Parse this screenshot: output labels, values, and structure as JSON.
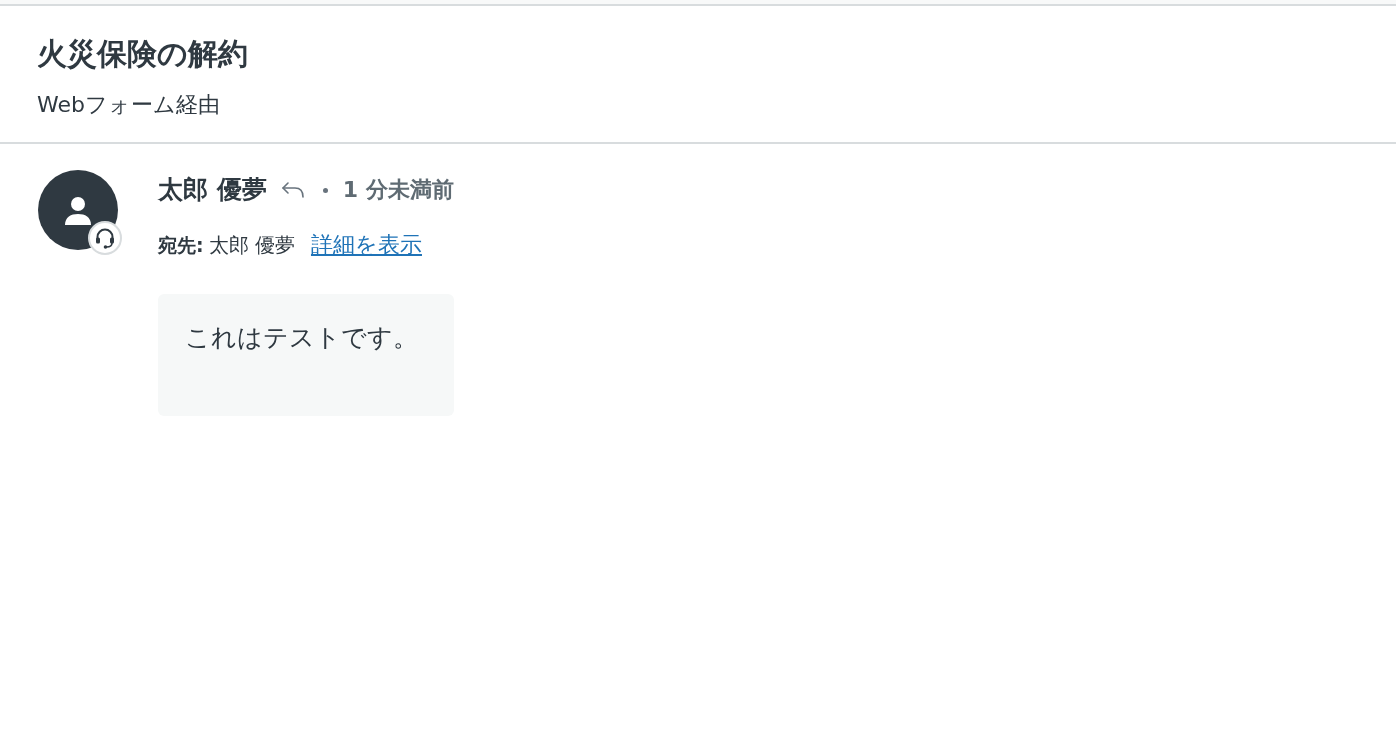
{
  "ticket": {
    "title": "火災保険の解約",
    "channel": "Webフォーム経由"
  },
  "messages": [
    {
      "author": "太郎 優夢",
      "time": "1 分未満前",
      "to_label": "宛先:",
      "to": "太郎 優夢",
      "details_link": "詳細を表示",
      "body": "これはテストです。"
    }
  ]
}
